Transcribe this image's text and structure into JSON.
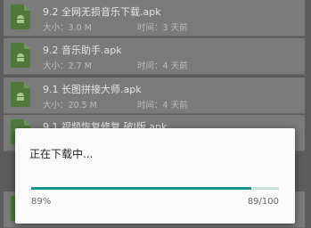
{
  "files": [
    {
      "name": "9.2 全网无损音乐下载.apk",
      "size": "大小：3.0 M",
      "time": "时间：3 天前"
    },
    {
      "name": "9.2 音乐助手.apk",
      "size": "大小：2.7 M",
      "time": "时间：4 天前"
    },
    {
      "name": "9.1 长图拼接大师.apk",
      "size": "大小：20.5 M",
      "time": "时间：4 天前"
    },
    {
      "name": "9.1 视频恢复修复 破J版.apk",
      "size": "",
      "time": ""
    },
    {
      "name": "",
      "size": "",
      "time": ""
    }
  ],
  "dialog": {
    "message": "正在下载中...",
    "percent_label": "89%",
    "count_label": "89/100",
    "progress": 0.89
  },
  "colors": {
    "accent": "#16968a",
    "apk_icon": "#4f7a3c"
  },
  "icons": {
    "file": "apk-android-icon"
  }
}
